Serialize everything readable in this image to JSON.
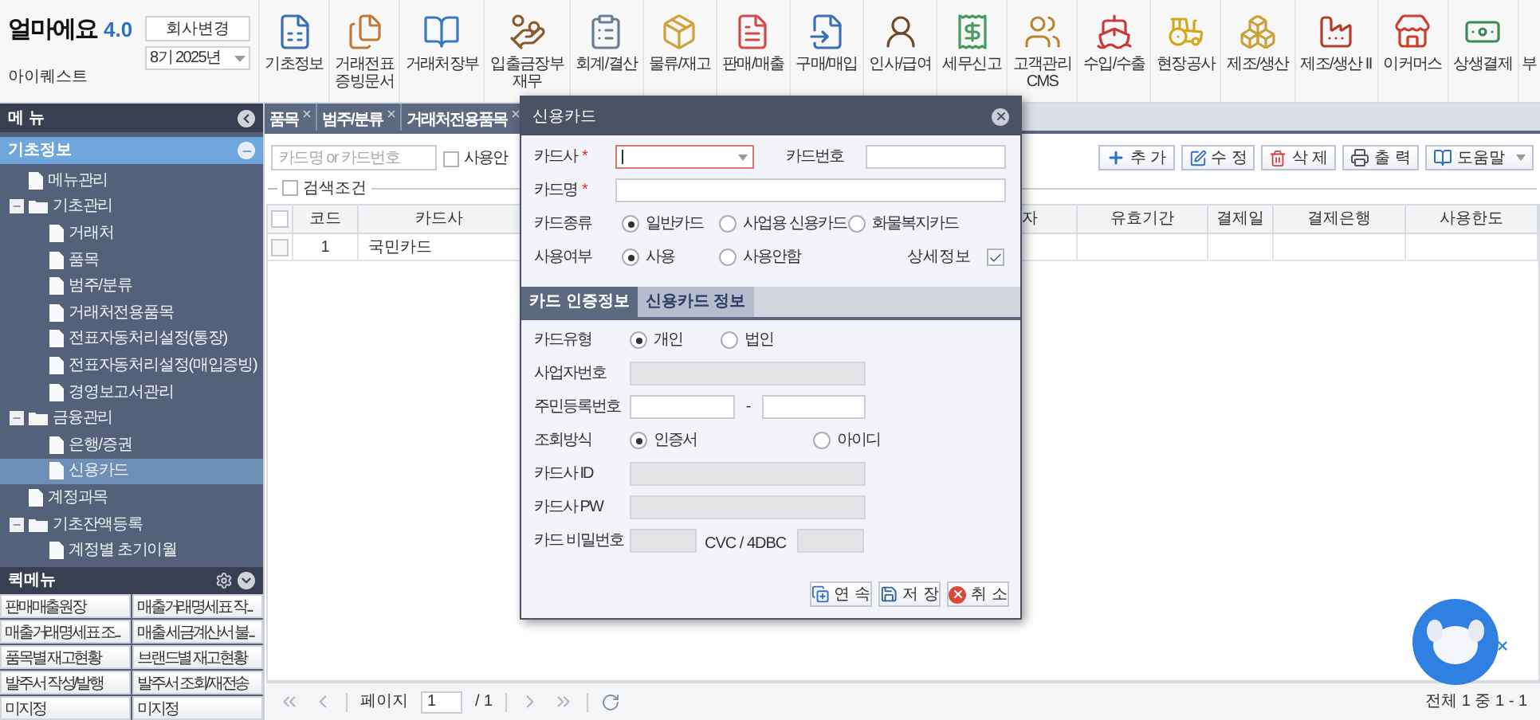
{
  "app": {
    "logo": "얼마에요",
    "version": "4.0",
    "company": "아이퀘스트",
    "company_button": "회사변경",
    "period": "8기 2025년"
  },
  "modules": [
    {
      "label": "기초정보"
    },
    {
      "label": "거래전표\n증빙문서"
    },
    {
      "label": "거래처장부"
    },
    {
      "label": "입출금장부\n재무"
    },
    {
      "label": "회계/결산"
    },
    {
      "label": "물류/재고"
    },
    {
      "label": "판매/매출"
    },
    {
      "label": "구매/매입"
    },
    {
      "label": "인사/급여"
    },
    {
      "label": "세무신고"
    },
    {
      "label": "고객관리\nCMS"
    },
    {
      "label": "수입/수출"
    },
    {
      "label": "현장공사"
    },
    {
      "label": "제조/생산"
    },
    {
      "label": "제조/생산 II"
    },
    {
      "label": "이커머스"
    },
    {
      "label": "상생결제"
    },
    {
      "label": "부"
    }
  ],
  "sidebar": {
    "title": "메 뉴",
    "section": "기초정보",
    "tree": [
      {
        "label": "메뉴관리",
        "kind": "file",
        "selected": false
      },
      {
        "label": "기초관리",
        "kind": "folder",
        "expanded": true,
        "selected": false,
        "children": [
          {
            "label": "거래처",
            "kind": "file",
            "selected": false
          },
          {
            "label": "품목",
            "kind": "file",
            "selected": false
          },
          {
            "label": "범주/분류",
            "kind": "file",
            "selected": false
          },
          {
            "label": "거래처전용품목",
            "kind": "file",
            "selected": false
          },
          {
            "label": "전표자동처리설정(통장)",
            "kind": "file",
            "selected": false
          },
          {
            "label": "전표자동처리설정(매입증빙)",
            "kind": "file",
            "selected": false
          },
          {
            "label": "경영보고서관리",
            "kind": "file",
            "selected": false
          }
        ]
      },
      {
        "label": "금융관리",
        "kind": "folder",
        "expanded": true,
        "selected": false,
        "children": [
          {
            "label": "은행/증권",
            "kind": "file",
            "selected": false
          },
          {
            "label": "신용카드",
            "kind": "file",
            "selected": true
          }
        ]
      },
      {
        "label": "계정과목",
        "kind": "file",
        "selected": false
      },
      {
        "label": "기초잔액등록",
        "kind": "folder",
        "expanded": true,
        "selected": false,
        "children": [
          {
            "label": "계정별 초기이월",
            "kind": "file",
            "selected": false
          }
        ]
      }
    ]
  },
  "quick_menu": {
    "title": "퀵메뉴",
    "items": [
      "판매매출원장",
      "매출거래명세표 작...",
      "매출거래명세표 조...",
      "매출 세금계산서 불...",
      "품목별 재고현황",
      "브랜드별 재고현황",
      "발주서 작성/발행",
      "발주서 조회/재전송",
      "미지정",
      "미지정"
    ]
  },
  "tabs": [
    {
      "label": "품목"
    },
    {
      "label": "범주/분류"
    },
    {
      "label": "거래처전용품목"
    }
  ],
  "toolbar": {
    "search_placeholder": "카드명 or 카드번호",
    "inactive_filter": {
      "label": "사용안",
      "checked": false
    },
    "buttons": [
      "추 가",
      "수 정",
      "삭 제",
      "출 력",
      "도움말"
    ]
  },
  "search_conditions": {
    "label": "검색조건",
    "checked": false
  },
  "table": {
    "columns": [
      "코드",
      "카드사",
      "자",
      "유효기간",
      "결제일",
      "결제은행",
      "사용한도"
    ],
    "select_all": false,
    "rows": [
      {
        "checked": false,
        "code": "1",
        "card_company": "국민카드"
      }
    ]
  },
  "pager": {
    "page_label": "페이지",
    "page": "1",
    "total": "/ 1",
    "summary": "전체 1 중 1 - 1"
  },
  "dialog": {
    "title": "신용카드",
    "card_company": {
      "label": "카드사",
      "mark": "*",
      "error": true
    },
    "card_number": {
      "label": "카드번호"
    },
    "card_name": {
      "label": "카드명",
      "mark": "*"
    },
    "card_type": {
      "label": "카드종류",
      "options": [
        {
          "label": "일반카드",
          "selected": true
        },
        {
          "label": "사업용 신용카드",
          "selected": false
        },
        {
          "label": "화물복지카드",
          "selected": false
        }
      ]
    },
    "usage": {
      "label": "사용여부",
      "options": [
        {
          "label": "사용",
          "selected": true
        },
        {
          "label": "사용안함",
          "selected": false
        }
      ]
    },
    "details": {
      "label": "상세정보",
      "checked": true
    },
    "tabs": [
      {
        "label": "카드 인증정보",
        "selected": true
      },
      {
        "label": "신용카드 정보",
        "selected": false
      }
    ],
    "holder_type": {
      "label": "카드유형",
      "options": [
        {
          "label": "개인",
          "selected": true
        },
        {
          "label": "법인",
          "selected": false
        }
      ]
    },
    "business_number": {
      "label": "사업자번호",
      "disabled": true
    },
    "resident_number": {
      "label": "주민등록번호",
      "separator": "-",
      "disabled": false
    },
    "lookup_method": {
      "label": "조회방식",
      "options": [
        {
          "label": "인증서",
          "selected": true
        },
        {
          "label": "아이디",
          "selected": false
        }
      ]
    },
    "card_id": {
      "label": "카드사 ID",
      "disabled": true
    },
    "card_pw": {
      "label": "카드사 PW",
      "disabled": true
    },
    "card_password": {
      "label": "카드 비밀번호",
      "disabled": true
    },
    "cvc": {
      "label": "CVC / 4DBC",
      "disabled": true
    },
    "buttons": [
      "연 속",
      "저 장",
      "취 소"
    ]
  }
}
